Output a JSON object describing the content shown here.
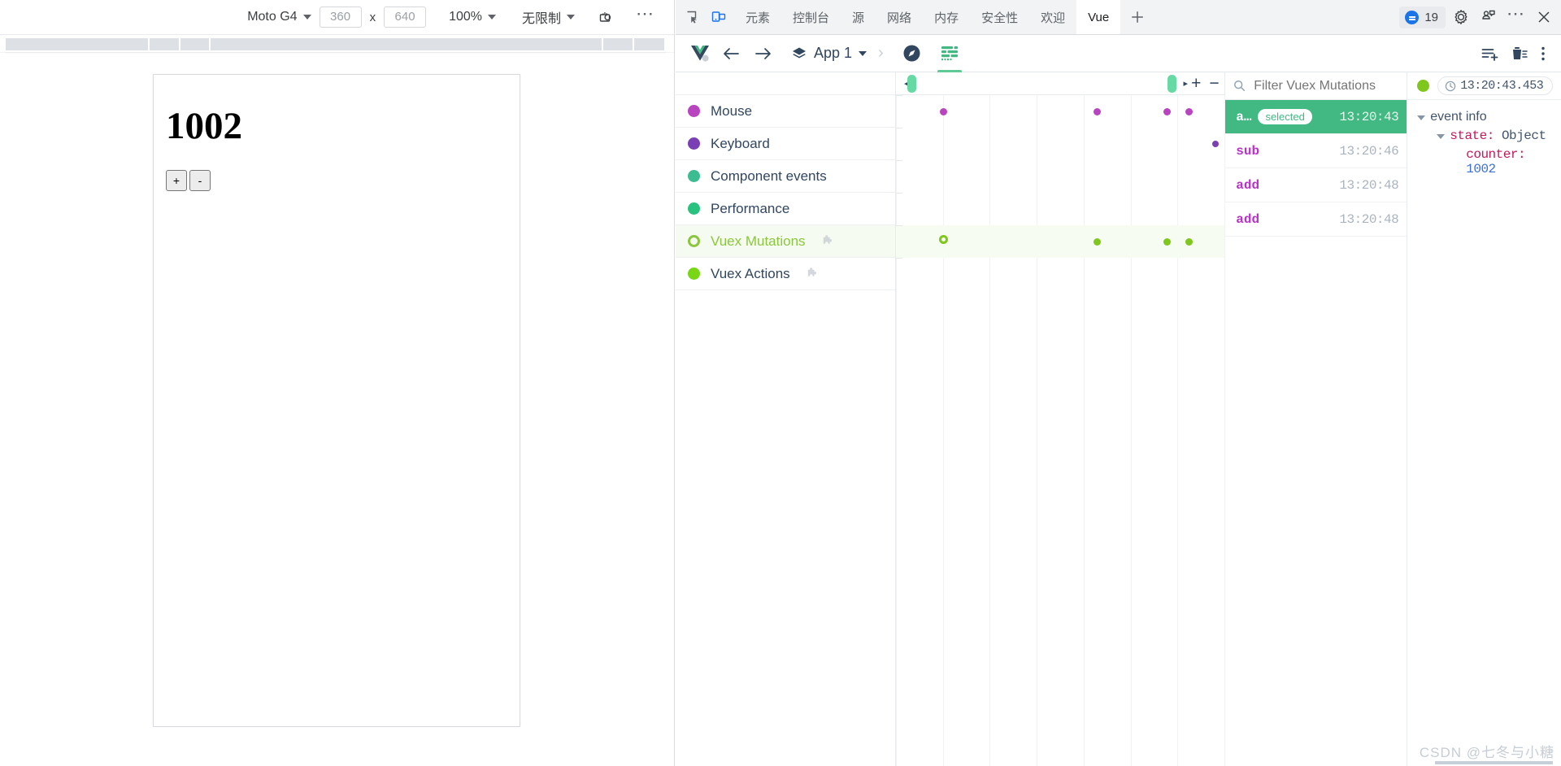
{
  "device_toolbar": {
    "device_name": "Moto G4",
    "width": "360",
    "height": "640",
    "x_label": "x",
    "zoom": "100%",
    "throttling": "无限制",
    "screenshot_icon": "rotate-screenshot-icon",
    "more_label": "…"
  },
  "app_preview": {
    "counter": "1002",
    "increment_label": "+",
    "decrement_label": "-"
  },
  "devtools": {
    "inspect_icon": "inspect-element-icon",
    "device_toggle_icon": "toggle-device-toolbar-icon",
    "tabs": [
      {
        "label": "元素",
        "active": false
      },
      {
        "label": "控制台",
        "active": false
      },
      {
        "label": "源",
        "active": false
      },
      {
        "label": "网络",
        "active": false
      },
      {
        "label": "内存",
        "active": false
      },
      {
        "label": "安全性",
        "active": false
      },
      {
        "label": "欢迎",
        "active": false
      },
      {
        "label": "Vue",
        "active": true
      }
    ],
    "add_tab_label": "+",
    "issues_count": "19",
    "settings_icon": "gear-icon",
    "feedback_icon": "feedback-icon",
    "more_icon": "more-options-icon",
    "close_icon": "close-icon"
  },
  "vue_toolbar": {
    "logo": "vue-logo-icon",
    "back_icon": "back-arrow-icon",
    "forward_icon": "forward-arrow-icon",
    "app_label": "App 1",
    "breadcrumb_sep": "›",
    "tabs": [
      {
        "name": "inspector-tab",
        "icon": "compass-icon",
        "active": false
      },
      {
        "name": "timeline-tab",
        "icon": "timeline-icon",
        "active": true
      }
    ],
    "actions": [
      {
        "name": "add-layer-button",
        "icon": "list-add-icon"
      },
      {
        "name": "clear-button",
        "icon": "trash-icon"
      },
      {
        "name": "menu-button",
        "icon": "vertical-dots-icon"
      }
    ]
  },
  "timeline": {
    "layers": [
      {
        "label": "Mouse",
        "color": "#b845bf",
        "selected": false,
        "plugin": false
      },
      {
        "label": "Keyboard",
        "color": "#7b3fb5",
        "selected": false,
        "plugin": false
      },
      {
        "label": "Component events",
        "color": "#3bbd91",
        "selected": false,
        "plugin": false
      },
      {
        "label": "Performance",
        "color": "#29c27f",
        "selected": false,
        "plugin": false
      },
      {
        "label": "Vuex Mutations",
        "color": "#8cc63f",
        "selected": true,
        "plugin": true
      },
      {
        "label": "Vuex Actions",
        "color": "#78d615",
        "selected": false,
        "plugin": false
      }
    ],
    "zoom_in_label": "+",
    "zoom_out_label": "−",
    "scroll_left_label": "◂",
    "scroll_right_label": "▸",
    "markers": [
      {
        "layer": 0,
        "x_pct": 14.5,
        "color": "#b845bf",
        "size": 9,
        "ring": false
      },
      {
        "layer": 0,
        "x_pct": 61.2,
        "color": "#b845bf",
        "size": 9,
        "ring": false
      },
      {
        "layer": 0,
        "x_pct": 82.5,
        "color": "#b845bf",
        "size": 9,
        "ring": false
      },
      {
        "layer": 0,
        "x_pct": 89.3,
        "color": "#b845bf",
        "size": 9,
        "ring": false
      },
      {
        "layer": 1,
        "x_pct": 97.2,
        "color": "#7b3fb5",
        "size": 8,
        "ring": false
      },
      {
        "layer": 4,
        "x_pct": 14.5,
        "color": "#7fc71d",
        "size": 11,
        "ring": true
      },
      {
        "layer": 4,
        "x_pct": 61.2,
        "color": "#7fc71d",
        "size": 9,
        "ring": false
      },
      {
        "layer": 4,
        "x_pct": 82.5,
        "color": "#7fc71d",
        "size": 9,
        "ring": false
      },
      {
        "layer": 4,
        "x_pct": 89.3,
        "color": "#7fc71d",
        "size": 9,
        "ring": false
      }
    ]
  },
  "events": {
    "filter_placeholder": "Filter Vuex Mutations",
    "search_icon": "search-icon",
    "rows": [
      {
        "label": "a…",
        "time": "13:20:43",
        "selected": true,
        "badge": "selected"
      },
      {
        "label": "sub",
        "time": "13:20:46",
        "selected": false,
        "badge": ""
      },
      {
        "label": "add",
        "time": "13:20:48",
        "selected": false,
        "badge": ""
      },
      {
        "label": "add",
        "time": "13:20:48",
        "selected": false,
        "badge": ""
      }
    ]
  },
  "event_info": {
    "status_dot_color": "#7fc71d",
    "clock_icon": "clock-icon",
    "timestamp": "13:20:43.453",
    "section_title": "event info",
    "state_key": "state:",
    "state_type": "Object",
    "counter_key": "counter:",
    "counter_value": "1002"
  },
  "watermark": {
    "text": "CSDN @七冬与小糖"
  }
}
